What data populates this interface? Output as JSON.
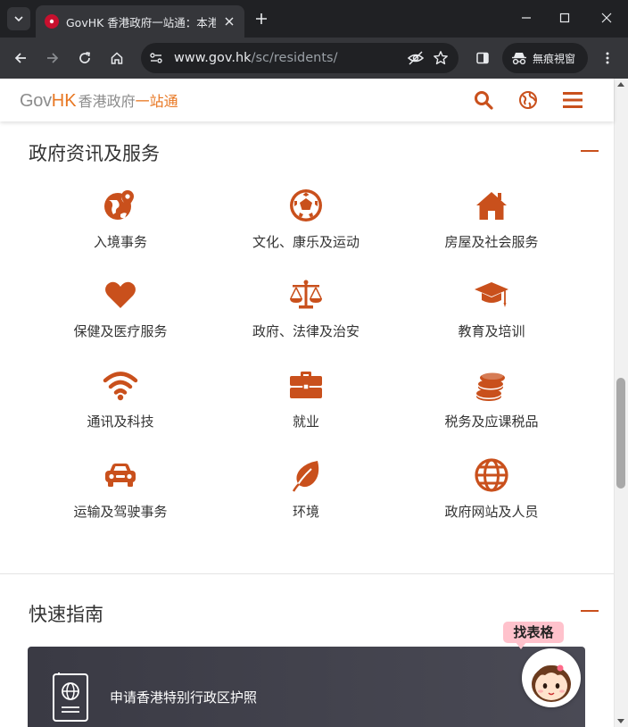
{
  "browser": {
    "tab_title": "GovHK 香港政府一站通：本港居民",
    "url_host": "www.gov.hk",
    "url_path": "/sc/residents/",
    "incognito_label": "無痕視窗"
  },
  "header": {
    "logo_gov": "Gov",
    "logo_hk": "HK",
    "logo_cn_a": "香港政府",
    "logo_cn_b": "一站通"
  },
  "sections": {
    "services_title": "政府资讯及服务",
    "guide_title": "快速指南"
  },
  "services": [
    {
      "label": "入境事务",
      "icon": "globe-pin-icon"
    },
    {
      "label": "文化、康乐及运动",
      "icon": "soccer-ball-icon"
    },
    {
      "label": "房屋及社会服务",
      "icon": "house-icon"
    },
    {
      "label": "保健及医疗服务",
      "icon": "heart-icon"
    },
    {
      "label": "政府、法律及治安",
      "icon": "scales-icon"
    },
    {
      "label": "教育及培训",
      "icon": "graduation-cap-icon"
    },
    {
      "label": "通讯及科技",
      "icon": "wifi-icon"
    },
    {
      "label": "就业",
      "icon": "briefcase-icon"
    },
    {
      "label": "税务及应课税品",
      "icon": "coins-icon"
    },
    {
      "label": "运输及驾驶事务",
      "icon": "car-icon"
    },
    {
      "label": "环境",
      "icon": "leaf-icon"
    },
    {
      "label": "政府网站及人员",
      "icon": "globe-icon"
    }
  ],
  "guide": {
    "first_item": "申请香港特别行政区护照"
  },
  "mascot": {
    "tag": "找表格"
  },
  "colors": {
    "accent": "#c9501c",
    "brand_orange": "#e87722"
  }
}
